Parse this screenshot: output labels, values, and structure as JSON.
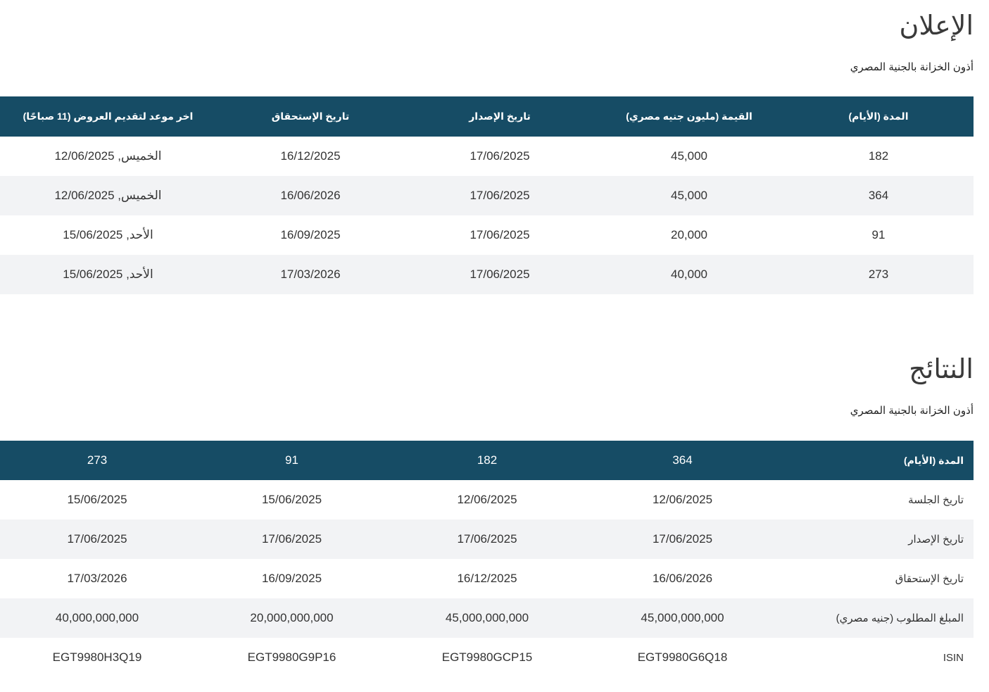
{
  "announcement": {
    "title": "الإعلان",
    "subtitle": "أذون الخزانة بالجنية المصري",
    "headers": {
      "tenor": "المدة (الأيام)",
      "amount": "القيمة (مليون جنيه مصري)",
      "issue_date": "تاريخ الإصدار",
      "maturity_date": "تاريخ الإستحقاق",
      "deadline": "اخر موعد لتقديم العروض (11 صباحًا)"
    },
    "rows": [
      {
        "tenor": "182",
        "amount": "45,000",
        "issue_date": "17/06/2025",
        "maturity_date": "16/12/2025",
        "deadline": "الخميس, 12/06/2025"
      },
      {
        "tenor": "364",
        "amount": "45,000",
        "issue_date": "17/06/2025",
        "maturity_date": "16/06/2026",
        "deadline": "الخميس, 12/06/2025"
      },
      {
        "tenor": "91",
        "amount": "20,000",
        "issue_date": "17/06/2025",
        "maturity_date": "16/09/2025",
        "deadline": "الأحد, 15/06/2025"
      },
      {
        "tenor": "273",
        "amount": "40,000",
        "issue_date": "17/06/2025",
        "maturity_date": "17/03/2026",
        "deadline": "الأحد, 15/06/2025"
      }
    ]
  },
  "results": {
    "title": "النتائج",
    "subtitle": "أذون الخزانة بالجنية المصري",
    "header": {
      "label": "المدة (الأيام)",
      "tenors": [
        "364",
        "182",
        "91",
        "273"
      ]
    },
    "rows": [
      {
        "label": "تاريخ الجلسة",
        "values": [
          "12/06/2025",
          "12/06/2025",
          "15/06/2025",
          "15/06/2025"
        ]
      },
      {
        "label": "تاريخ الإصدار",
        "values": [
          "17/06/2025",
          "17/06/2025",
          "17/06/2025",
          "17/06/2025"
        ]
      },
      {
        "label": "تاريخ الإستحقاق",
        "values": [
          "16/06/2026",
          "16/12/2025",
          "16/09/2025",
          "17/03/2026"
        ]
      },
      {
        "label": "المبلغ المطلوب (جنيه مصري)",
        "values": [
          "45,000,000,000",
          "45,000,000,000",
          "20,000,000,000",
          "40,000,000,000"
        ]
      },
      {
        "label": "ISIN",
        "values": [
          "EGT9980G6Q18",
          "EGT9980GCP15",
          "EGT9980G9P16",
          "EGT9980H3Q19"
        ]
      }
    ]
  }
}
